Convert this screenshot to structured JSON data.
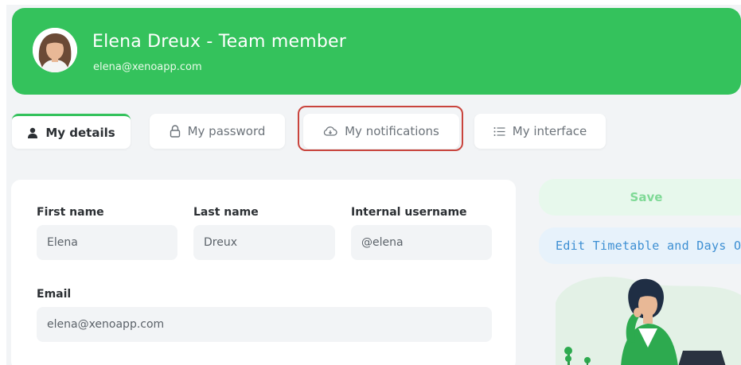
{
  "header": {
    "title": "Elena Dreux - Team member",
    "email": "elena@xenoapp.com",
    "accent_color": "#34c25c"
  },
  "tabs": [
    {
      "label": "My details",
      "icon": "user-icon",
      "active": true
    },
    {
      "label": "My password",
      "icon": "lock-icon",
      "active": false
    },
    {
      "label": "My notifications",
      "icon": "cloud-icon",
      "active": false,
      "highlighted": true
    },
    {
      "label": "My interface",
      "icon": "list-icon",
      "active": false
    }
  ],
  "form": {
    "first_name_label": "First name",
    "first_name_value": "Elena",
    "last_name_label": "Last name",
    "last_name_value": "Dreux",
    "username_label": "Internal username",
    "username_value": "@elena",
    "email_label": "Email",
    "email_value": "elena@xenoapp.com"
  },
  "actions": {
    "save_label": "Save",
    "timetable_label": "Edit Timetable and Days Off"
  },
  "colors": {
    "highlight_border": "#c9443d",
    "save_bg": "#e7f8ec",
    "timetable_text": "#3d8fd3"
  }
}
